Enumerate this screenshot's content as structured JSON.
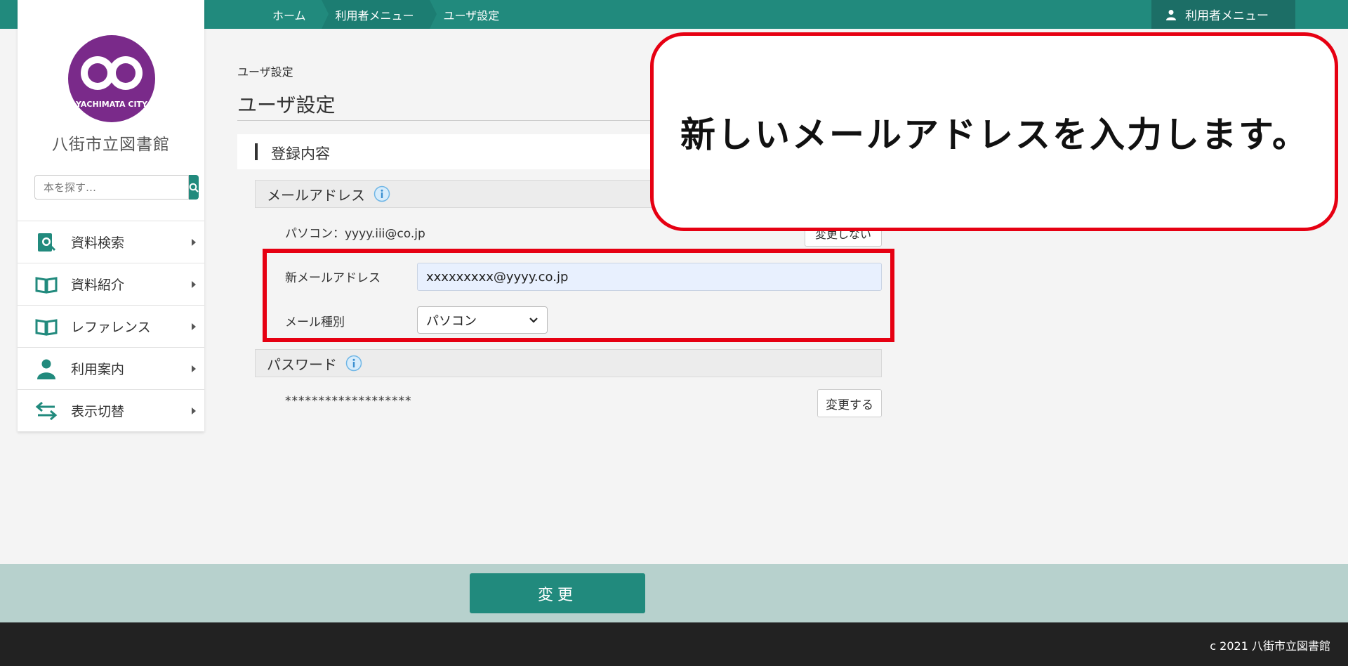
{
  "breadcrumbs": [
    "ホーム",
    "利用者メニュー",
    "ユーザ設定"
  ],
  "header": {
    "user_menu_label": "利用者メニュー"
  },
  "sidebar": {
    "logo_text": "YACHIMATA CITY",
    "library_name": "八街市立図書館",
    "search_placeholder": "本を探す…",
    "items": [
      {
        "label": "資料検索",
        "icon": "book-search-icon"
      },
      {
        "label": "資料紹介",
        "icon": "open-book-icon"
      },
      {
        "label": "レファレンス",
        "icon": "open-book-icon"
      },
      {
        "label": "利用案内",
        "icon": "person-icon"
      },
      {
        "label": "表示切替",
        "icon": "swap-arrows-icon"
      }
    ]
  },
  "main": {
    "breadcrumb_small": "ユーザ設定",
    "page_title": "ユーザ設定",
    "section_label": "登録内容",
    "email": {
      "header": "メールアドレス",
      "current": "パソコン：yyyy.iii@co.jp",
      "keep_button": "変更しない",
      "new_label": "新メールアドレス",
      "new_value": "xxxxxxxxx@yyyy.co.jp",
      "type_label": "メール種別",
      "type_value": "パソコン"
    },
    "password": {
      "header": "パスワード",
      "masked": "*******************",
      "change_button": "変更する"
    }
  },
  "callout": {
    "text": "新しいメールアドレスを入力します。"
  },
  "footer": {
    "submit_label": "変更",
    "copyright": "c 2021 八街市立図書館"
  },
  "colors": {
    "accent": "#218a7d",
    "highlight": "#e60012",
    "logo": "#7a2a8a"
  }
}
